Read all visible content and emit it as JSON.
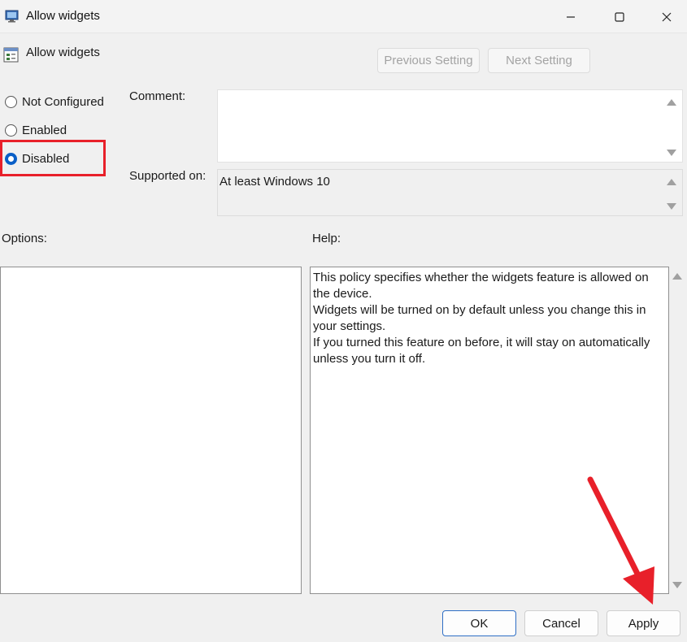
{
  "window": {
    "title": "Allow widgets",
    "icon": "group-policy-icon",
    "controls": [
      "minimize-icon",
      "maximize-icon",
      "close-icon"
    ]
  },
  "policy": {
    "name": "Allow widgets",
    "icon": "policy-setting-icon"
  },
  "nav": {
    "previous_label": "Previous Setting",
    "next_label": "Next Setting"
  },
  "state": {
    "options": [
      "Not Configured",
      "Enabled",
      "Disabled"
    ],
    "selected": "Disabled"
  },
  "comment": {
    "label": "Comment:",
    "value": ""
  },
  "supported": {
    "label": "Supported on:",
    "value": "At least Windows 10"
  },
  "options_pane": {
    "label": "Options:"
  },
  "help": {
    "label": "Help:",
    "paragraphs": [
      "This policy specifies whether the widgets feature is allowed on the device.",
      "Widgets will be turned on by default unless you change this in your settings.",
      "If you turned this feature on before, it will stay on automatically unless you turn it off."
    ]
  },
  "buttons": {
    "ok": "OK",
    "cancel": "Cancel",
    "apply": "Apply"
  },
  "annotations": {
    "highlight_color": "#e8202a",
    "accent_color": "#0a5fc7"
  }
}
